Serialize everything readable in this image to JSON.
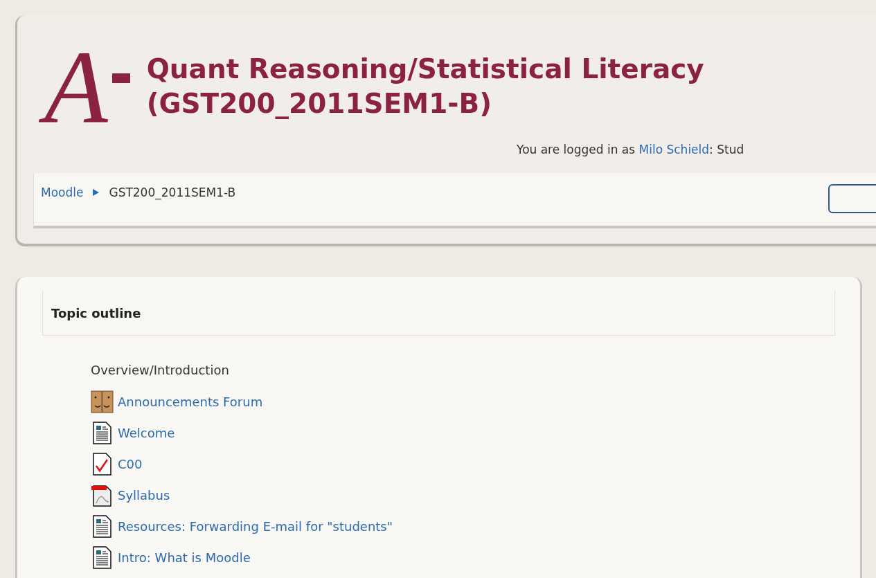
{
  "header": {
    "logo_letter": "A",
    "title_lines": [
      "Quant Reasoning/Statistical Literacy",
      "(GST200_2011SEM1-B)"
    ],
    "login": {
      "prefix": "You are logged in as ",
      "user": "Milo Schield",
      "suffix": ": Stud"
    }
  },
  "breadcrumb": [
    {
      "label": "Moodle",
      "link": true
    },
    {
      "label": "GST200_2011SEM1-B",
      "link": false
    }
  ],
  "section": {
    "heading": "Topic outline",
    "summary": "Overview/Introduction",
    "items": [
      {
        "kind": "forum",
        "label": "Announcements Forum"
      },
      {
        "kind": "page",
        "label": "Welcome"
      },
      {
        "kind": "quiz",
        "label": "C00"
      },
      {
        "kind": "pdf",
        "label": "Syllabus"
      },
      {
        "kind": "page",
        "label": "Resources: Forwarding E-mail for \"students\""
      },
      {
        "kind": "page",
        "label": "Intro: What is Moodle"
      }
    ]
  }
}
